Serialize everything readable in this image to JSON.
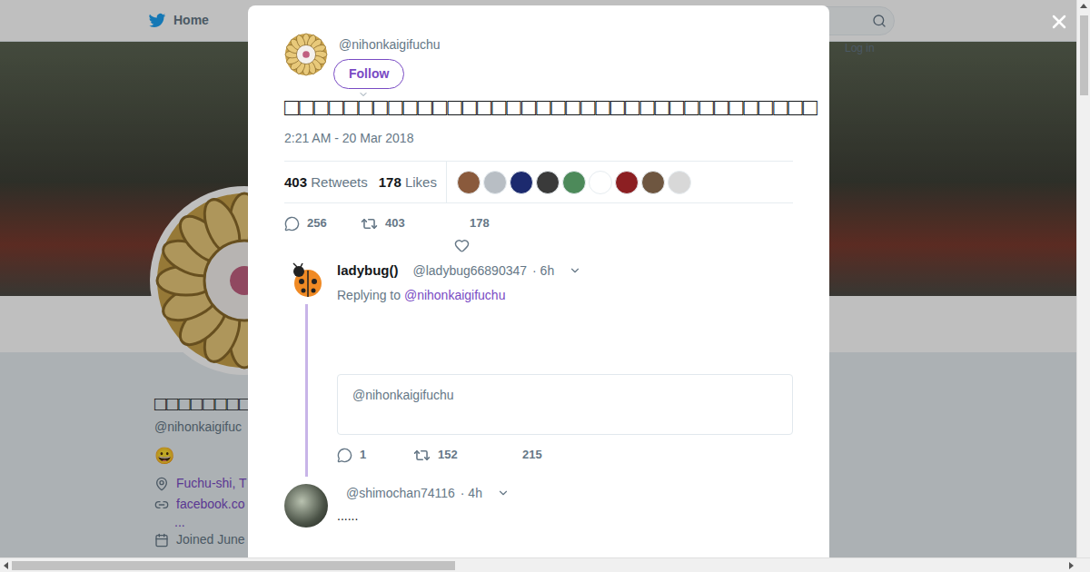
{
  "header": {
    "nav": [
      {
        "label": "Home",
        "selected": true
      }
    ],
    "login": "Log in"
  },
  "profile": {
    "name": "□□□□□□□□□□",
    "handle": "@nihonkaigifuc",
    "emoji": "😀",
    "location": "Fuchu-shi, T",
    "link": "facebook.co",
    "more": "...",
    "joined": "Joined June"
  },
  "tweet": {
    "handle": "@nihonkaigifuchu",
    "follow": "Follow",
    "text": "□□□□□□□□□□□□□□□□□□□□□□□□□□□□□□□□□□□□",
    "time": "2:21 AM - 20 Mar 2018",
    "retweets": "403",
    "retweets_label": "Retweets",
    "likes": "178",
    "likes_label": "Likes",
    "likers": [
      {
        "color": "#8a5a3c"
      },
      {
        "color": "#b8bec4"
      },
      {
        "color": "#1c2a6e"
      },
      {
        "color": "#3a3a3a"
      },
      {
        "color": "#4d8a5a"
      },
      {
        "color": "#ffffff"
      },
      {
        "color": "#8c1f22"
      },
      {
        "color": "#6e5640"
      },
      {
        "color": "#d8d8d8"
      }
    ],
    "actions": {
      "replies": "256",
      "retweets": "403",
      "likes": "178"
    }
  },
  "replies": [
    {
      "name": "ladybug()",
      "handle": "@ladybug66890347",
      "time": "· 6h",
      "replying_prefix": "Replying to",
      "replying_to": "@nihonkaigifuchu",
      "quote": "@nihonkaigifuchu",
      "text": "",
      "replies": "1",
      "retweets": "152",
      "likes": "215",
      "thread": true,
      "avatar": "ladybug"
    },
    {
      "name": "",
      "handle": "@shimochan74116",
      "time": "· 4h",
      "replying_prefix": "",
      "replying_to": "",
      "quote": "",
      "text": "......",
      "replies": "",
      "retweets": "",
      "likes": "",
      "thread": false,
      "avatar": "photo"
    }
  ]
}
